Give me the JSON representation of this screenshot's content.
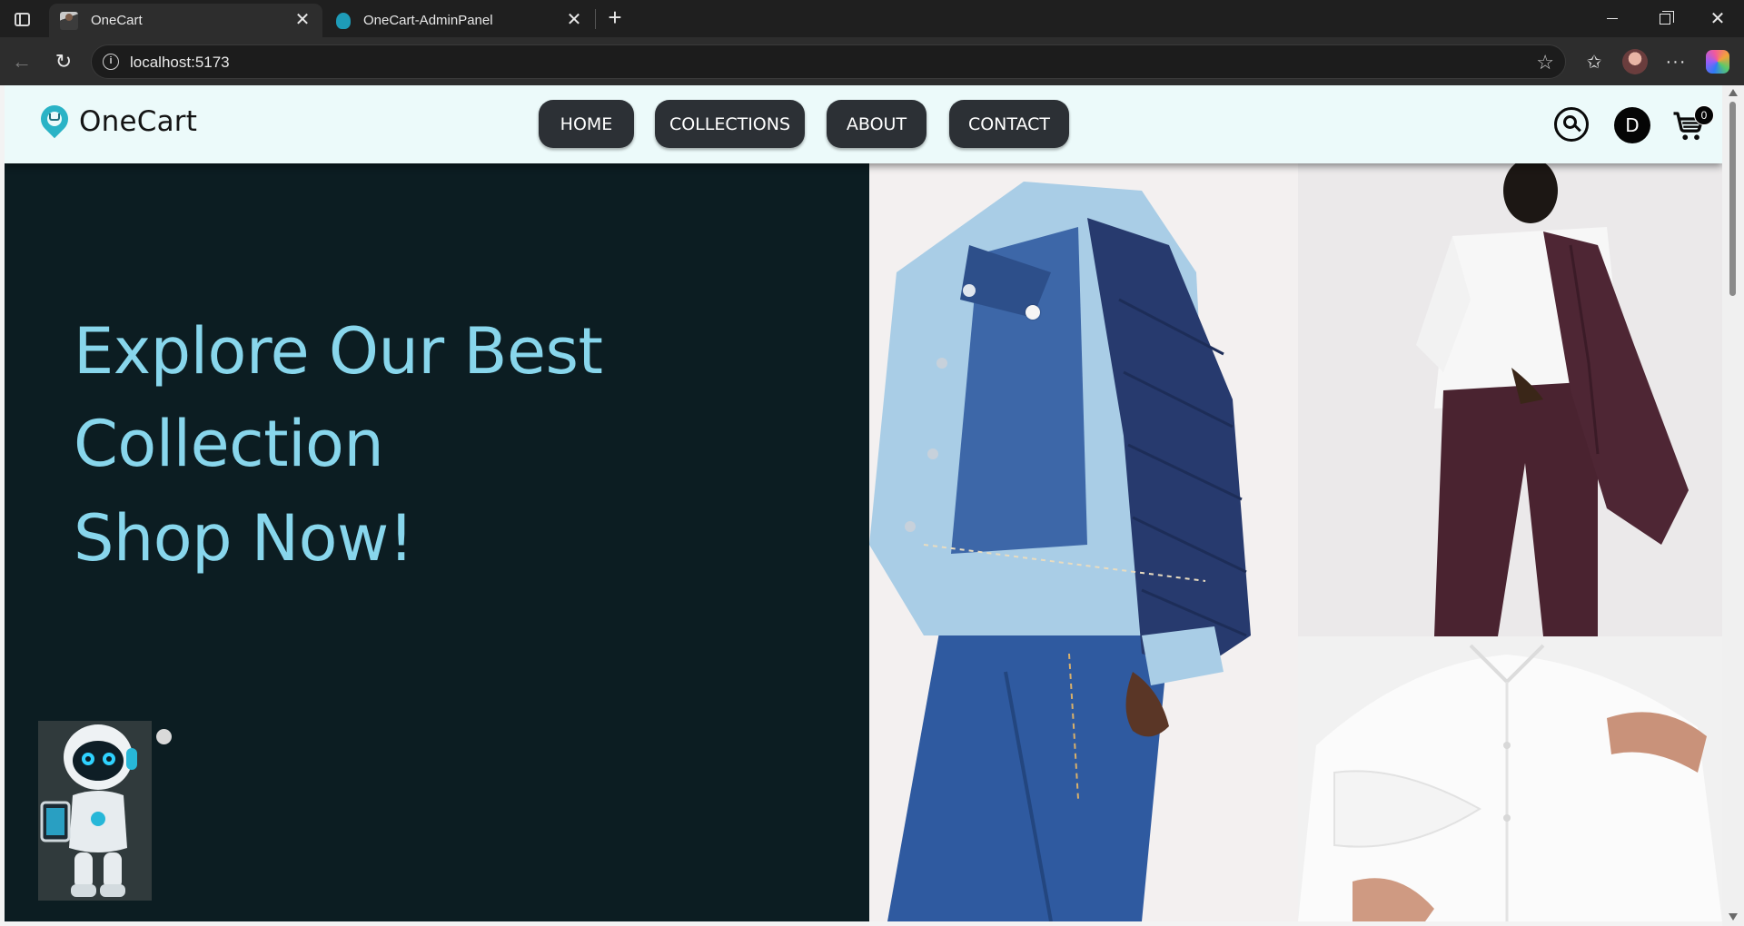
{
  "browser": {
    "tabs": [
      {
        "title": "OneCart",
        "active": true
      },
      {
        "title": "OneCart-AdminPanel",
        "active": false
      }
    ],
    "url": "localhost:5173",
    "close_glyph": "✕",
    "new_tab_glyph": "+"
  },
  "site": {
    "brand": "OneCart",
    "nav": [
      {
        "label": "HOME"
      },
      {
        "label": "COLLECTIONS"
      },
      {
        "label": "ABOUT"
      },
      {
        "label": "CONTACT"
      }
    ],
    "user_initial": "D",
    "cart_count": "0"
  },
  "hero": {
    "lines": [
      "Explore Our Best",
      "Collection",
      "Shop Now!"
    ],
    "accent_color": "#88d6ec",
    "background_color": "#0c1d22"
  },
  "icons": {
    "search": "search-icon",
    "cart": "cart-icon",
    "robot": "chatbot-robot-image"
  }
}
